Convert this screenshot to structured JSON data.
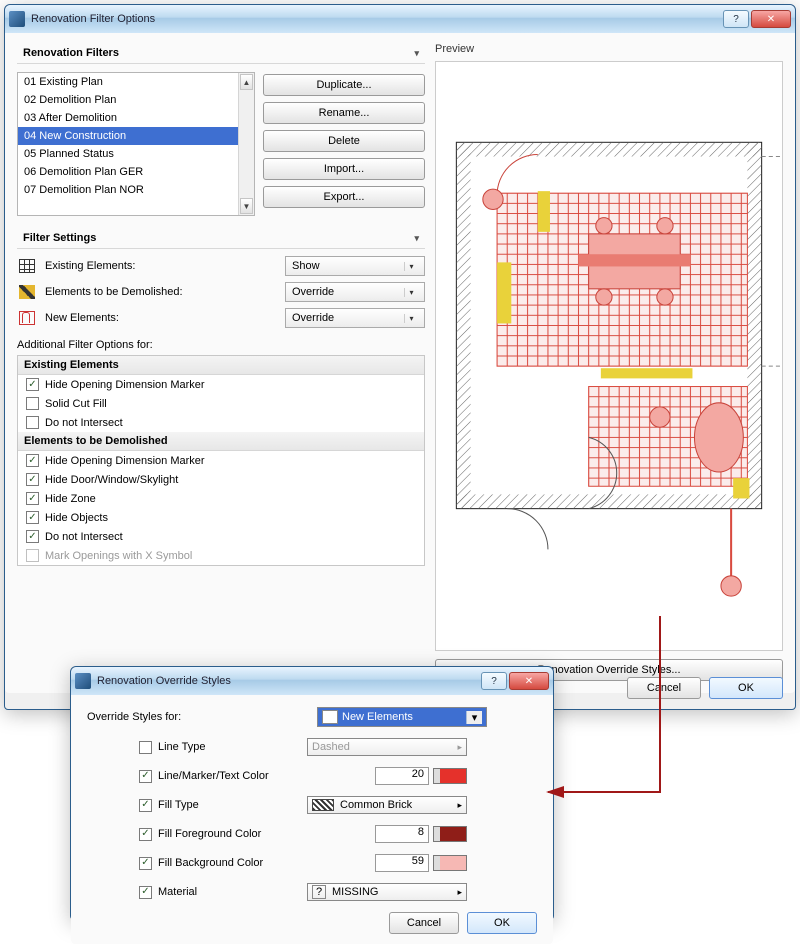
{
  "main": {
    "title": "Renovation Filter Options",
    "filtersHeader": "Renovation Filters",
    "filters": [
      "01 Existing Plan",
      "02 Demolition Plan",
      "03 After Demolition",
      "04 New Construction",
      "05 Planned Status",
      "06 Demolition Plan GER",
      "07 Demolition Plan NOR"
    ],
    "selectedFilterIndex": 3,
    "actions": {
      "duplicate": "Duplicate...",
      "rename": "Rename...",
      "delete": "Delete",
      "import": "Import...",
      "export": "Export..."
    },
    "settingsHeader": "Filter Settings",
    "settingRows": [
      {
        "icon": "brick",
        "label": "Existing Elements:",
        "value": "Show"
      },
      {
        "icon": "demo",
        "label": "Elements to be Demolished:",
        "value": "Override"
      },
      {
        "icon": "new",
        "label": "New Elements:",
        "value": "Override"
      }
    ],
    "additionalLabel": "Additional Filter Options for:",
    "groups": [
      {
        "title": "Existing Elements",
        "opts": [
          {
            "label": "Hide Opening Dimension Marker",
            "checked": true
          },
          {
            "label": "Solid Cut Fill",
            "checked": false
          },
          {
            "label": "Do not Intersect",
            "checked": false
          }
        ]
      },
      {
        "title": "Elements to be Demolished",
        "opts": [
          {
            "label": "Hide Opening Dimension Marker",
            "checked": true
          },
          {
            "label": "Hide Door/Window/Skylight",
            "checked": true
          },
          {
            "label": "Hide Zone",
            "checked": true
          },
          {
            "label": "Hide Objects",
            "checked": true
          },
          {
            "label": "Do not Intersect",
            "checked": true
          },
          {
            "label": "Mark Openings with X Symbol",
            "checked": false,
            "disabled": true
          }
        ]
      }
    ],
    "previewLabel": "Preview",
    "overrideStylesBtn": "Renovation Override Styles...",
    "cancel": "Cancel",
    "ok": "OK"
  },
  "override": {
    "title": "Renovation Override Styles",
    "forLabel": "Override Styles for:",
    "forValue": "New Elements",
    "rows": [
      {
        "label": "Line Type",
        "checked": false,
        "kind": "pick",
        "value": "Dashed"
      },
      {
        "label": "Line/Marker/Text Color",
        "checked": true,
        "kind": "color",
        "value": "20",
        "colorClass": "c-red"
      },
      {
        "label": "Fill Type",
        "checked": true,
        "kind": "pick",
        "value": "Common Brick",
        "icon": "fill"
      },
      {
        "label": "Fill Foreground Color",
        "checked": true,
        "kind": "color",
        "value": "8",
        "colorClass": "c-darkred"
      },
      {
        "label": "Fill Background Color",
        "checked": true,
        "kind": "color",
        "value": "59",
        "colorClass": "c-pink"
      },
      {
        "label": "Material",
        "checked": true,
        "kind": "pick",
        "value": "MISSING",
        "icon": "q"
      }
    ],
    "cancel": "Cancel",
    "ok": "OK"
  }
}
